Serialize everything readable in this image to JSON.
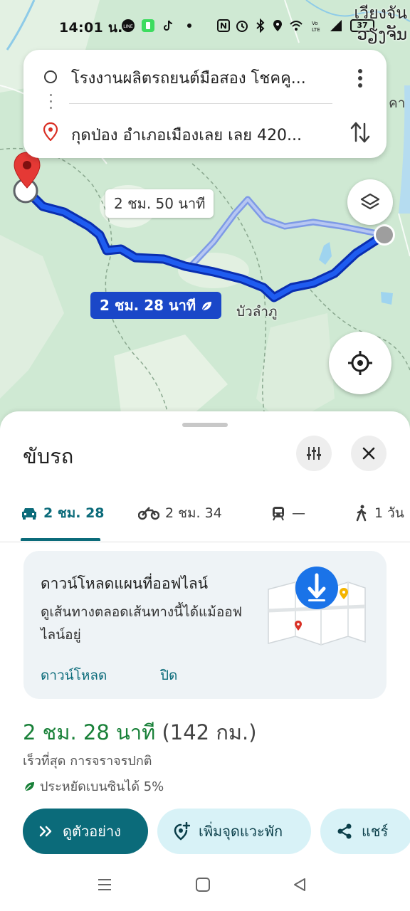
{
  "status_bar": {
    "time": "14:01 น.",
    "battery": "37"
  },
  "map": {
    "city_label_line1": "เวียงจัน",
    "city_label_line2": "ວຽງຈັນ",
    "partial_label": "คา",
    "alt_route_duration": "2 ชม. 50 นาที",
    "main_route_duration": "2 ชม. 28 นาที",
    "town_label": "บัวลำภู"
  },
  "route_card": {
    "origin": "โรงงานผลิตรถยนต์มือสอง โชคคู...",
    "destination": "กุดป่อง อำเภอเมืองเลย เลย 420..."
  },
  "sheet": {
    "title": "ขับรถ",
    "modes": [
      {
        "icon": "car-icon",
        "label": "2 ชม. 28",
        "active": true
      },
      {
        "icon": "motorcycle-icon",
        "label": "2 ชม. 34",
        "active": false
      },
      {
        "icon": "train-icon",
        "label": "—",
        "active": false
      },
      {
        "icon": "walk-icon",
        "label": "1 วัน",
        "active": false
      }
    ],
    "offline": {
      "title": "ดาวน์โหลดแผนที่ออฟไลน์",
      "description": "ดูเส้นทางตลอดเส้นทางนี้ได้แม้ออฟไลน์อยู่",
      "download_label": "ดาวน์โหลด",
      "close_label": "ปิด"
    },
    "eta_time": "2 ชม. 28 นาที",
    "eta_distance": "(142 กม.)",
    "route_description": "เร็วที่สุด การจราจรปกติ",
    "fuel_saving": "ประหยัดเบนซินได้ 5%",
    "actions": {
      "preview": "ดูตัวอย่าง",
      "add_stop": "เพิ่มจุดแวะพัก",
      "share": "แชร์"
    }
  },
  "colors": {
    "accent_teal": "#0b6b7a",
    "route_blue": "#1a47c8",
    "eta_green": "#188038",
    "map_green": "#cfe9d3"
  }
}
